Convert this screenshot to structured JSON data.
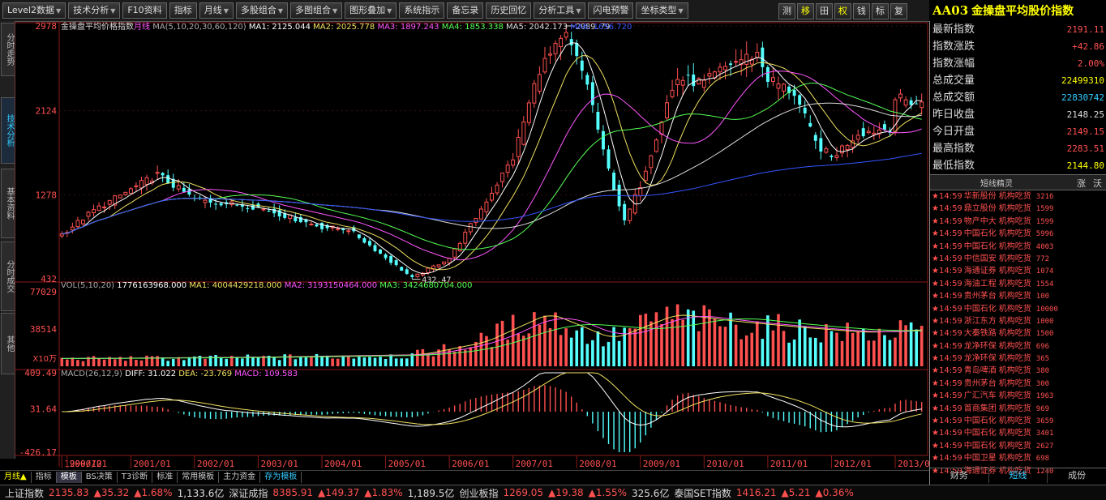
{
  "toolbar": {
    "buttons": [
      {
        "label": "Level2数据",
        "arrow": true
      },
      {
        "label": "技术分析",
        "arrow": true
      },
      {
        "label": "F10资料",
        "arrow": false
      },
      {
        "label": "指标",
        "arrow": false
      },
      {
        "label": "月线",
        "arrow": true
      },
      {
        "label": "多股组合",
        "arrow": true
      },
      {
        "label": "多图组合",
        "arrow": true
      },
      {
        "label": "图形叠加",
        "arrow": true
      },
      {
        "label": "系统指示",
        "arrow": false
      },
      {
        "label": "备忘录",
        "arrow": false
      },
      {
        "label": "历史回忆",
        "arrow": false
      },
      {
        "label": "分析工具",
        "arrow": true
      },
      {
        "label": "闪电预警",
        "arrow": false
      },
      {
        "label": "坐标类型",
        "arrow": true
      }
    ],
    "right_buttons": [
      {
        "label": "测",
        "on": false
      },
      {
        "label": "移",
        "on": true
      },
      {
        "label": "田",
        "on": false
      },
      {
        "label": "权",
        "on": true
      },
      {
        "label": "钱",
        "on": false
      },
      {
        "label": "标",
        "on": false
      },
      {
        "label": "复",
        "on": false
      }
    ]
  },
  "title": {
    "code": "AA03",
    "name": "金操盘平均股价指数"
  },
  "left_tabs": [
    {
      "label": "分时走势",
      "active": false
    },
    {
      "label": "技术分析",
      "active": true
    },
    {
      "label": "基本资料",
      "active": false
    },
    {
      "label": "分时成交",
      "active": false
    },
    {
      "label": "其他",
      "active": false
    }
  ],
  "chart_data": [
    {
      "type": "candlestick",
      "name": "金操盘平均价格指数",
      "period": "月线",
      "ylim": [
        432,
        2978
      ],
      "y_ticks": [
        "2978",
        "2124",
        "1278",
        "432"
      ],
      "x_ticks": [
        "1999/12",
        "2000/01",
        "2001/01",
        "2002/01",
        "2003/01",
        "2004/01",
        "2005/01",
        "2006/01",
        "2007/01",
        "2008/01",
        "2009/01",
        "2010/01",
        "2011/01",
        "2012/01",
        "2013/01"
      ],
      "annotations": [
        {
          "label": "2989.79",
          "x": "2007/11"
        },
        {
          "label": "432.47",
          "x": "2005/06"
        }
      ],
      "indicator": "MA(5,10,20,30,60,120)",
      "legend": [
        {
          "name": "MA1: 2125.044",
          "color": "#ffffff"
        },
        {
          "name": "MA2: 2025.778",
          "color": "#f0e060"
        },
        {
          "name": "MA3: 1897.243",
          "color": "#ff55ff"
        },
        {
          "name": "MA4: 1853.338",
          "color": "#55ff55"
        },
        {
          "name": "MA5: 2042.173",
          "color": "#dddddd"
        },
        {
          "name": "MA6: 1656.720",
          "color": "#3355ff"
        }
      ],
      "keyframes": {
        "dates": [
          "1999/12",
          "2000/06",
          "2001/06",
          "2002/01",
          "2003/01",
          "2004/01",
          "2004/06",
          "2005/06",
          "2006/01",
          "2006/06",
          "2007/01",
          "2007/06",
          "2007/11",
          "2008/03",
          "2008/06",
          "2008/10",
          "2009/01",
          "2009/06",
          "2009/08",
          "2010/01",
          "2010/06",
          "2010/11",
          "2011/01",
          "2011/06",
          "2011/10",
          "2012/01",
          "2012/06",
          "2012/12",
          "2013/01",
          "2013/06"
        ],
        "close": [
          880,
          1120,
          1480,
          1230,
          1150,
          950,
          930,
          440,
          640,
          1050,
          1650,
          2550,
          2870,
          2400,
          1700,
          1000,
          1380,
          2200,
          2450,
          2400,
          2600,
          2700,
          2450,
          2300,
          1800,
          1650,
          1900,
          1950,
          2250,
          2191
        ]
      }
    },
    {
      "type": "bar",
      "name": "VOL",
      "indicator": "VOL(5,10,20)",
      "y_ticks": [
        "77029",
        "38514"
      ],
      "unit": "X10万",
      "legend": [
        {
          "name": "1776163968.000",
          "color": "#ffffff"
        },
        {
          "name": "MA1: 4004429218.000",
          "color": "#f0e060"
        },
        {
          "name": "MA2: 3193150464.000",
          "color": "#ff55ff"
        },
        {
          "name": "MA3: 3424680704.000",
          "color": "#55ff55"
        }
      ],
      "keyframes": {
        "dates": [
          "1999/12",
          "2003/01",
          "2005/06",
          "2006/06",
          "2007/06",
          "2008/06",
          "2009/06",
          "2010/06",
          "2011/06",
          "2012/06",
          "2013/06"
        ],
        "volume": [
          8000,
          9500,
          12000,
          25000,
          55000,
          28000,
          54000,
          46000,
          40000,
          35000,
          38000
        ]
      }
    },
    {
      "type": "line",
      "name": "MACD",
      "indicator": "MACD(26,12,9)",
      "y_ticks": [
        "409.49",
        "31.64",
        "-426.17"
      ],
      "legend": [
        {
          "name": "DIFF: 31.022",
          "color": "#ffffff"
        },
        {
          "name": "DEA: -23.769",
          "color": "#f0e060"
        },
        {
          "name": "MACD: 109.583",
          "color": "#ff55ff"
        }
      ]
    }
  ],
  "stats": [
    {
      "label": "最新指数",
      "value": "2191.11",
      "color": "#ff5050"
    },
    {
      "label": "指数涨跌",
      "value": "+42.86",
      "color": "#ff5050"
    },
    {
      "label": "指数涨幅",
      "value": "2.00%",
      "color": "#ff5050"
    },
    {
      "label": "总成交量",
      "value": "22499310",
      "color": "#ffff00"
    },
    {
      "label": "总成交额",
      "value": "22830742",
      "color": "#3cf"
    },
    {
      "label": "昨日收盘",
      "value": "2148.25",
      "color": "#ddd"
    },
    {
      "label": "今日开盘",
      "value": "2149.15",
      "color": "#ff5050"
    },
    {
      "label": "最高指数",
      "value": "2283.51",
      "color": "#ff5050"
    },
    {
      "label": "最低指数",
      "value": "2144.80",
      "color": "#ffff00"
    }
  ],
  "wizard": {
    "title": "短线精灵",
    "btn_b": "涨",
    "btn_c": "沃",
    "items": [
      {
        "time": "14:59",
        "stock": "华新股份",
        "event": "机构吃货",
        "num": "3216"
      },
      {
        "time": "14:59",
        "stock": "鼎立股份",
        "event": "机构吃货",
        "num": "1599"
      },
      {
        "time": "14:59",
        "stock": "物产中大",
        "event": "机构吃货",
        "num": "1599"
      },
      {
        "time": "14:59",
        "stock": "中国石化",
        "event": "机构吃货",
        "num": "5996"
      },
      {
        "time": "14:59",
        "stock": "中国石化",
        "event": "机构吃货",
        "num": "4003"
      },
      {
        "time": "14:59",
        "stock": "中信国安",
        "event": "机构吃货",
        "num": "772"
      },
      {
        "time": "14:59",
        "stock": "海通证券",
        "event": "机构吃货",
        "num": "1074"
      },
      {
        "time": "14:59",
        "stock": "海油工程",
        "event": "机构吃货",
        "num": "1554"
      },
      {
        "time": "14:59",
        "stock": "贵州茅台",
        "event": "机构吃货",
        "num": "100"
      },
      {
        "time": "14:59",
        "stock": "中国石化",
        "event": "机构吃货",
        "num": "10000"
      },
      {
        "time": "14:59",
        "stock": "浙江东方",
        "event": "机构吃货",
        "num": "1000"
      },
      {
        "time": "14:59",
        "stock": "大秦铁路",
        "event": "机构吃货",
        "num": "1500"
      },
      {
        "time": "14:59",
        "stock": "龙净环保",
        "event": "机构吃货",
        "num": "696"
      },
      {
        "time": "14:59",
        "stock": "龙净环保",
        "event": "机构吃货",
        "num": "365"
      },
      {
        "time": "14:59",
        "stock": "青岛啤酒",
        "event": "机构吃货",
        "num": "380"
      },
      {
        "time": "14:59",
        "stock": "贵州茅台",
        "event": "机构吃货",
        "num": "300"
      },
      {
        "time": "14:59",
        "stock": "广汇汽车",
        "event": "机构吃货",
        "num": "1963"
      },
      {
        "time": "14:59",
        "stock": "首商集团",
        "event": "机构吃货",
        "num": "969"
      },
      {
        "time": "14:59",
        "stock": "中国石化",
        "event": "机构吃货",
        "num": "3659"
      },
      {
        "time": "14:59",
        "stock": "中国石化",
        "event": "机构吃货",
        "num": "3401"
      },
      {
        "time": "14:59",
        "stock": "中国石化",
        "event": "机构吃货",
        "num": "2627"
      },
      {
        "time": "14:59",
        "stock": "中国卫星",
        "event": "机构吃货",
        "num": "698"
      },
      {
        "time": "14:59",
        "stock": "海通证券",
        "event": "机构吃货",
        "num": "1240"
      }
    ]
  },
  "side_tabs": [
    {
      "label": "财务",
      "active": false
    },
    {
      "label": "短线",
      "active": true
    },
    {
      "label": "成份",
      "active": false
    }
  ],
  "bottom_tabs": [
    {
      "label": "月线▲",
      "cls": "yellow"
    },
    {
      "label": "指标",
      "cls": ""
    },
    {
      "label": "模板",
      "cls": "active"
    },
    {
      "label": "BS决策",
      "cls": ""
    },
    {
      "label": "T3诊断",
      "cls": ""
    },
    {
      "label": "标准",
      "cls": ""
    },
    {
      "label": "常用模板",
      "cls": ""
    },
    {
      "label": "主力资金",
      "cls": ""
    },
    {
      "label": "存为模板",
      "cls": "blue"
    }
  ],
  "ticker": [
    {
      "name": "上证指数",
      "value": "2135.83",
      "change": "▲35.32",
      "pct": "▲1.68%",
      "vol": "1,133.6亿"
    },
    {
      "name": "深证成指",
      "value": "8385.91",
      "change": "▲149.37",
      "pct": "▲1.83%",
      "vol": "1,189.5亿"
    },
    {
      "name": "创业板指",
      "value": "1269.05",
      "change": "▲19.38",
      "pct": "▲1.55%",
      "vol": "325.6亿"
    },
    {
      "name": "泰国SET指数",
      "value": "1416.21",
      "change": "▲5.21",
      "pct": "▲0.36%",
      "vol": ""
    }
  ]
}
